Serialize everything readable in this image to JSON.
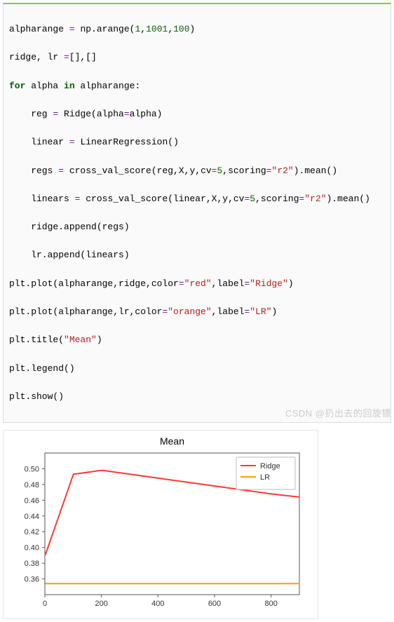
{
  "code": {
    "l1a": "alpharange ",
    "l1b": " np.arange(",
    "l2a": "ridge, lr ",
    "l2b": "[],[]",
    "l3a": " alpha ",
    "l3b": " alpharange:",
    "l4": "    reg ",
    "l4b": " Ridge(alpha",
    "l4c": "alpha)",
    "l5a": "    linear ",
    "l5b": " LinearRegression()",
    "l6a": "    regs ",
    "l6b": " cross_val_score(reg,X,y,cv",
    "l6c": ",scoring",
    "l6d": ").mean()",
    "l7a": "    linears ",
    "l7b": " cross_val_score(linear,X,y,cv",
    "l8": "    ridge.append(regs)",
    "l9": "    lr.append(linears)",
    "l10a": "plt.plot(alpharange,ridge,color",
    "l10b": ",label",
    "l11a": "plt.plot(alpharange,lr,color",
    "l12": "plt.title(",
    "l13": "plt.legend()",
    "l14": "plt.show()",
    "n1": "1",
    "n1001": "1001",
    "n100": "100",
    "n5": "5",
    "eq": "=",
    "for": "for",
    "in": "in",
    "s_r2": "\"r2\"",
    "s_red": "\"red\"",
    "s_ridge": "\"Ridge\"",
    "s_orange": "\"orange\"",
    "s_lr": "\"LR\"",
    "s_mean": "\"Mean\"",
    "paren_close": ")"
  },
  "chart_data": {
    "type": "line",
    "title": "Mean",
    "xlabel": "",
    "ylabel": "",
    "xlim": [
      0,
      900
    ],
    "ylim": [
      0.34,
      0.52
    ],
    "xticks": [
      0,
      200,
      400,
      600,
      800
    ],
    "yticks": [
      0.36,
      0.38,
      0.4,
      0.42,
      0.44,
      0.46,
      0.48,
      0.5
    ],
    "series": [
      {
        "name": "Ridge",
        "color": "#ff3b30",
        "x": [
          1,
          101,
          201,
          301,
          401,
          501,
          601,
          701,
          801,
          901
        ],
        "y": [
          0.39,
          0.493,
          0.498,
          0.493,
          0.488,
          0.483,
          0.478,
          0.473,
          0.468,
          0.464
        ]
      },
      {
        "name": "LR",
        "color": "#ff9f0a",
        "x": [
          1,
          101,
          201,
          301,
          401,
          501,
          601,
          701,
          801,
          901
        ],
        "y": [
          0.354,
          0.354,
          0.354,
          0.354,
          0.354,
          0.354,
          0.354,
          0.354,
          0.354,
          0.354
        ]
      }
    ],
    "legend": {
      "entries": [
        "Ridge",
        "LR"
      ]
    }
  },
  "watermark": "CSDN @扔出去的回旋镖"
}
